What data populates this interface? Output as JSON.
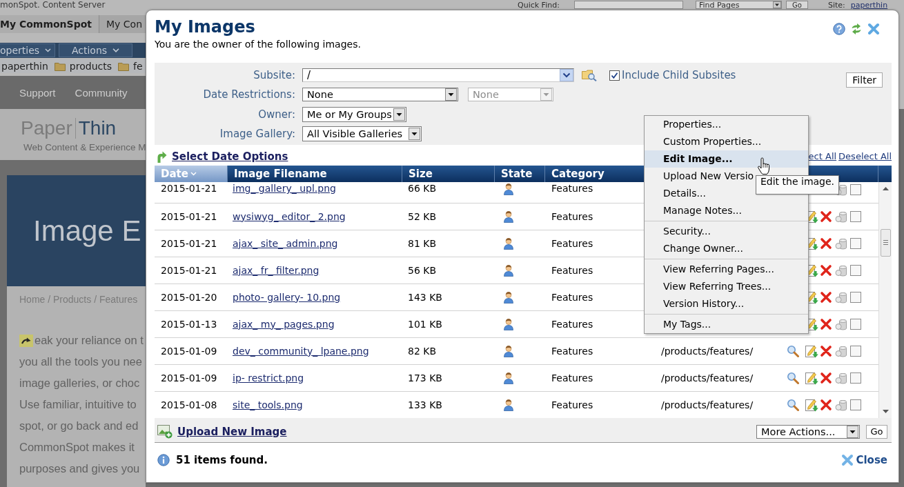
{
  "background_page": {
    "top_bar": {
      "product_name": "monSpot. Content Server",
      "quick_find_label": "Quick Find:",
      "find_select": "Find Pages",
      "go_button": "Go",
      "site_label": "Site:",
      "site_link": "paperthin"
    },
    "tabs": [
      {
        "label": "My CommonSpot",
        "selected": true
      },
      {
        "label": "My Con",
        "selected": false
      }
    ],
    "menu_buttons": [
      "operties",
      "Actions"
    ],
    "folder_path": [
      "paperthin",
      "products",
      "fe"
    ],
    "site_nav": [
      "Support",
      "Community"
    ],
    "logo_words": [
      "Paper",
      "Thin"
    ],
    "tagline": "Web Content & Experience M",
    "hero_title": "Image E",
    "breadcrumb": "Home / Products / Features",
    "paragraphs": [
      [
        "eak your reliance on t",
        "you all the tools you nee",
        "image galleries, or choc"
      ],
      [
        "Use familiar, intuitive to",
        "spot, or go back and ed",
        "CommonSpot makes it",
        "purposes and gives you"
      ]
    ]
  },
  "dialog": {
    "title": "My Images",
    "subtitle": "You are the owner of the following images.",
    "filters": {
      "subsite": {
        "label": "Subsite:",
        "value": "/"
      },
      "include_child_subsites": {
        "label": "Include Child Subsites",
        "checked": true
      },
      "date_restrictions": {
        "label": "Date Restrictions:",
        "value": "None",
        "end_select": {
          "value": "None",
          "disabled": true
        }
      },
      "owner": {
        "label": "Owner:",
        "value": "Me or My Groups"
      },
      "image_gallery": {
        "label": "Image Gallery:",
        "value": "All Visible Galleries"
      },
      "filter_button": "Filter"
    },
    "select_date_options": "Select Date Options",
    "select_all": "ect All",
    "deselect_all": "Deselect All",
    "table": {
      "columns": [
        {
          "label": "Date",
          "sorted": true
        },
        {
          "label": "Image Filename",
          "sorted": false
        },
        {
          "label": "Size",
          "sorted": false
        },
        {
          "label": "State",
          "sorted": false
        },
        {
          "label": "Category",
          "sorted": false
        }
      ],
      "rows": [
        {
          "date": "2015-01-21",
          "filename": "img_ gallery_ upl.png",
          "size": "66 KB",
          "category": "Features",
          "checked": false
        },
        {
          "date": "2015-01-21",
          "filename": "wysiwyg_ editor_ 2.png",
          "size": "52 KB",
          "category": "Features",
          "checked": false
        },
        {
          "date": "2015-01-21",
          "filename": "ajax_ site_ admin.png",
          "size": "81 KB",
          "category": "Features",
          "checked": false
        },
        {
          "date": "2015-01-21",
          "filename": "ajax_ fr_ filter.png",
          "size": "56 KB",
          "category": "Features",
          "checked": false
        },
        {
          "date": "2015-01-20",
          "filename": "photo- gallery- 10.png",
          "size": "143 KB",
          "category": "Features",
          "checked": false
        },
        {
          "date": "2015-01-13",
          "filename": "ajax_ my_ pages.png",
          "size": "101 KB",
          "category": "Features",
          "checked": false
        },
        {
          "date": "2015-01-09",
          "filename": "dev_ community_ lpane.png",
          "size": "82 KB",
          "category": "Features",
          "path": "/products/features/",
          "checked": false
        },
        {
          "date": "2015-01-09",
          "filename": "ip- restrict.png",
          "size": "173 KB",
          "category": "Features",
          "path": "/products/features/",
          "checked": false
        },
        {
          "date": "2015-01-08",
          "filename": "site_ tools.png",
          "size": "133 KB",
          "category": "Features",
          "path": "/products/features/",
          "checked": false
        }
      ]
    },
    "upload_link": "Upload New Image",
    "more_actions": {
      "value": "More Actions...",
      "go_button": "Go"
    },
    "status": "51 items found.",
    "close_button": "Close",
    "context_menu": {
      "groups": [
        [
          {
            "label": "Properties...",
            "selected": false
          },
          {
            "label": "Custom Properties...",
            "selected": false
          },
          {
            "label": "Edit Image...",
            "selected": true
          },
          {
            "label": "Upload New Versio",
            "selected": false
          },
          {
            "label": "Details...",
            "selected": false
          },
          {
            "label": "Manage Notes...",
            "selected": false
          }
        ],
        [
          {
            "label": "Security...",
            "selected": false
          },
          {
            "label": "Change Owner...",
            "selected": false
          }
        ],
        [
          {
            "label": "View Referring Pages...",
            "selected": false
          },
          {
            "label": "View Referring Trees...",
            "selected": false
          },
          {
            "label": "Version History...",
            "selected": false
          }
        ],
        [
          {
            "label": "My Tags...",
            "selected": false
          }
        ]
      ],
      "tooltip": "Edit the image."
    }
  }
}
